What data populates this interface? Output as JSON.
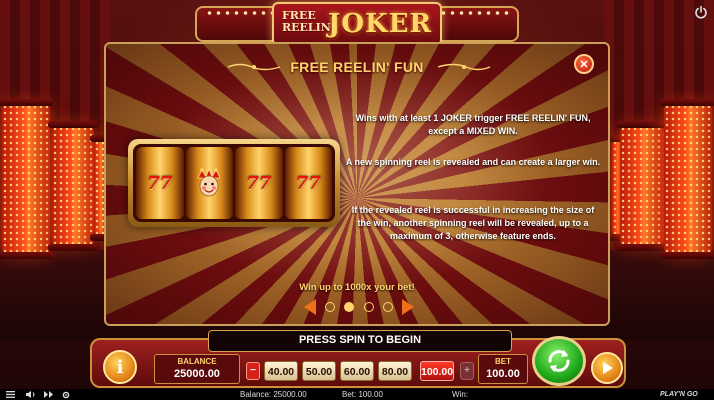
{
  "logo": {
    "line1": "FREE",
    "line2": "REELIN'",
    "main": "JOKER"
  },
  "panel": {
    "title": "FREE REELIN' FUN",
    "close_label": "✕",
    "reel_symbols": [
      "77",
      "joker",
      "77",
      "77"
    ],
    "paragraph_1": "Wins with at least 1 JOKER trigger FREE REELIN' FUN, except a MIXED WIN.",
    "paragraph_2": "A new spinning reel is revealed and can create a larger win.",
    "paragraph_3": "If the revealed reel is successful in increasing the size of the win, another spinning reel will be revealed, up to a maximum of 3, otherwise feature ends.",
    "win_up_to": "Win up to 1000x your bet!",
    "pager": {
      "pages": 4,
      "current": 2
    }
  },
  "message": "PRESS SPIN TO BEGIN",
  "controls": {
    "info_label": "i",
    "balance_label": "BALANCE",
    "balance_value": "25000.00",
    "bet_minus": "−",
    "bet_plus": "+",
    "bet_options": [
      "40.00",
      "50.00",
      "60.00",
      "80.00",
      "100.00"
    ],
    "bet_selected": "100.00",
    "bet_label": "BET",
    "bet_value": "100.00"
  },
  "status_bar": {
    "balance": "Balance: 25000.00",
    "bet": "Bet: 100.00",
    "win": "Win:",
    "brand": "PLAY'N GO"
  },
  "colors": {
    "accent_gold": "#ffd470",
    "panel_red": "#7c1012",
    "spin_green": "#1fa81a",
    "selected_bet": "#d8201a"
  },
  "icons": [
    "power-icon",
    "menu-icon",
    "sound-icon",
    "turbo-icon",
    "settings-icon",
    "close-icon",
    "info-icon",
    "spin-icon",
    "autoplay-icon",
    "joker-symbol-icon"
  ]
}
